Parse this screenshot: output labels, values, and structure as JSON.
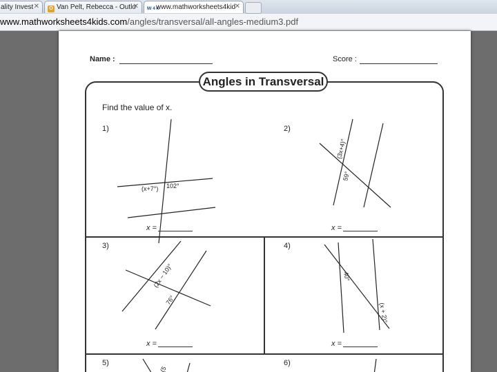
{
  "browser": {
    "tabs": [
      {
        "label": "ality Invest",
        "close": "✕"
      },
      {
        "label": "Van Pelt, Rebecca - Outlo",
        "close": "✕",
        "icon": "outlook-icon"
      },
      {
        "label": "www.mathworksheets4kid",
        "close": "✕",
        "icon": "mw-icon",
        "favicon_text": "M/ 4 K"
      }
    ],
    "url_host": "www.mathworksheets4kids.com",
    "url_path": "/angles/transversal/all-angles-medium3.pdf"
  },
  "worksheet": {
    "name_label": "Name :",
    "score_label": "Score :",
    "title": "Angles in Transversal",
    "instruction": "Find the value of x.",
    "problems": [
      {
        "number": "1)",
        "labels": [
          "(x+7°)",
          "102°"
        ],
        "answer_label": "x ="
      },
      {
        "number": "2)",
        "labels": [
          "(3x+4)°",
          "59°"
        ],
        "answer_label": "x ="
      },
      {
        "number": "3)",
        "labels": [
          "(2x − 10)°",
          "76°"
        ],
        "answer_label": "x ="
      },
      {
        "number": "4)",
        "labels": [
          "40°",
          "(x + 2)°"
        ],
        "answer_label": "x ="
      },
      {
        "number": "5)",
        "labels": [
          "(5"
        ]
      },
      {
        "number": "6)",
        "labels": []
      }
    ]
  }
}
